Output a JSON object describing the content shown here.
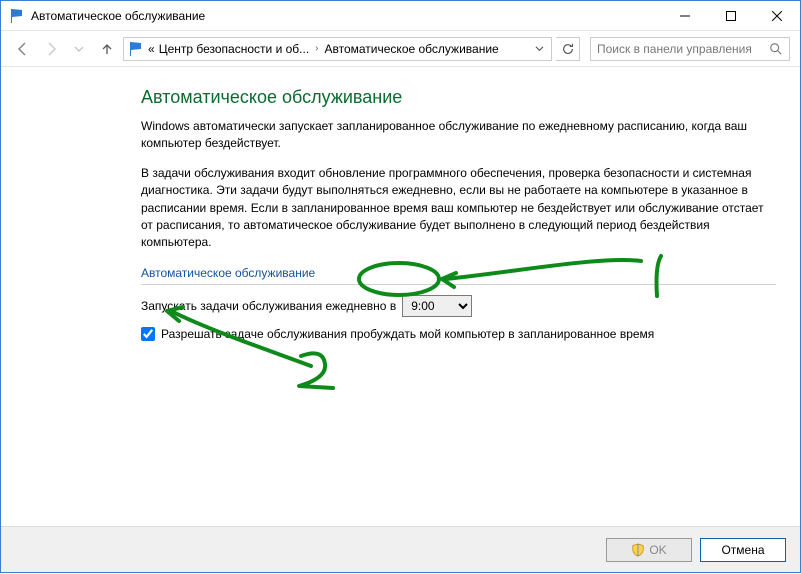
{
  "window": {
    "title": "Автоматическое обслуживание"
  },
  "nav": {
    "breadcrumb_prefix": "«",
    "crumb1": "Центр безопасности и об...",
    "crumb2": "Автоматическое обслуживание",
    "search_placeholder": "Поиск в панели управления"
  },
  "main": {
    "heading": "Автоматическое обслуживание",
    "para1": "Windows автоматически запускает запланированное обслуживание по ежедневному расписанию, когда ваш компьютер бездействует.",
    "para2": "В задачи обслуживания входит обновление программного обеспечения, проверка безопасности и системная диагностика. Эти задачи будут выполняться ежедневно, если вы не работаете на компьютере в указанное в расписании время. Если в запланированное время ваш компьютер не бездействует или обслуживание отстает от расписания, то автоматическое обслуживание будет выполнено в следующий период бездействия компьютера.",
    "section_label": "Автоматическое обслуживание",
    "schedule_label": "Запускать задачи обслуживания ежедневно в",
    "schedule_value": "9:00",
    "wake_label": "Разрешать задаче обслуживания пробуждать мой компьютер в запланированное время",
    "wake_checked": true
  },
  "footer": {
    "ok_label": "OK",
    "cancel_label": "Отмена"
  }
}
